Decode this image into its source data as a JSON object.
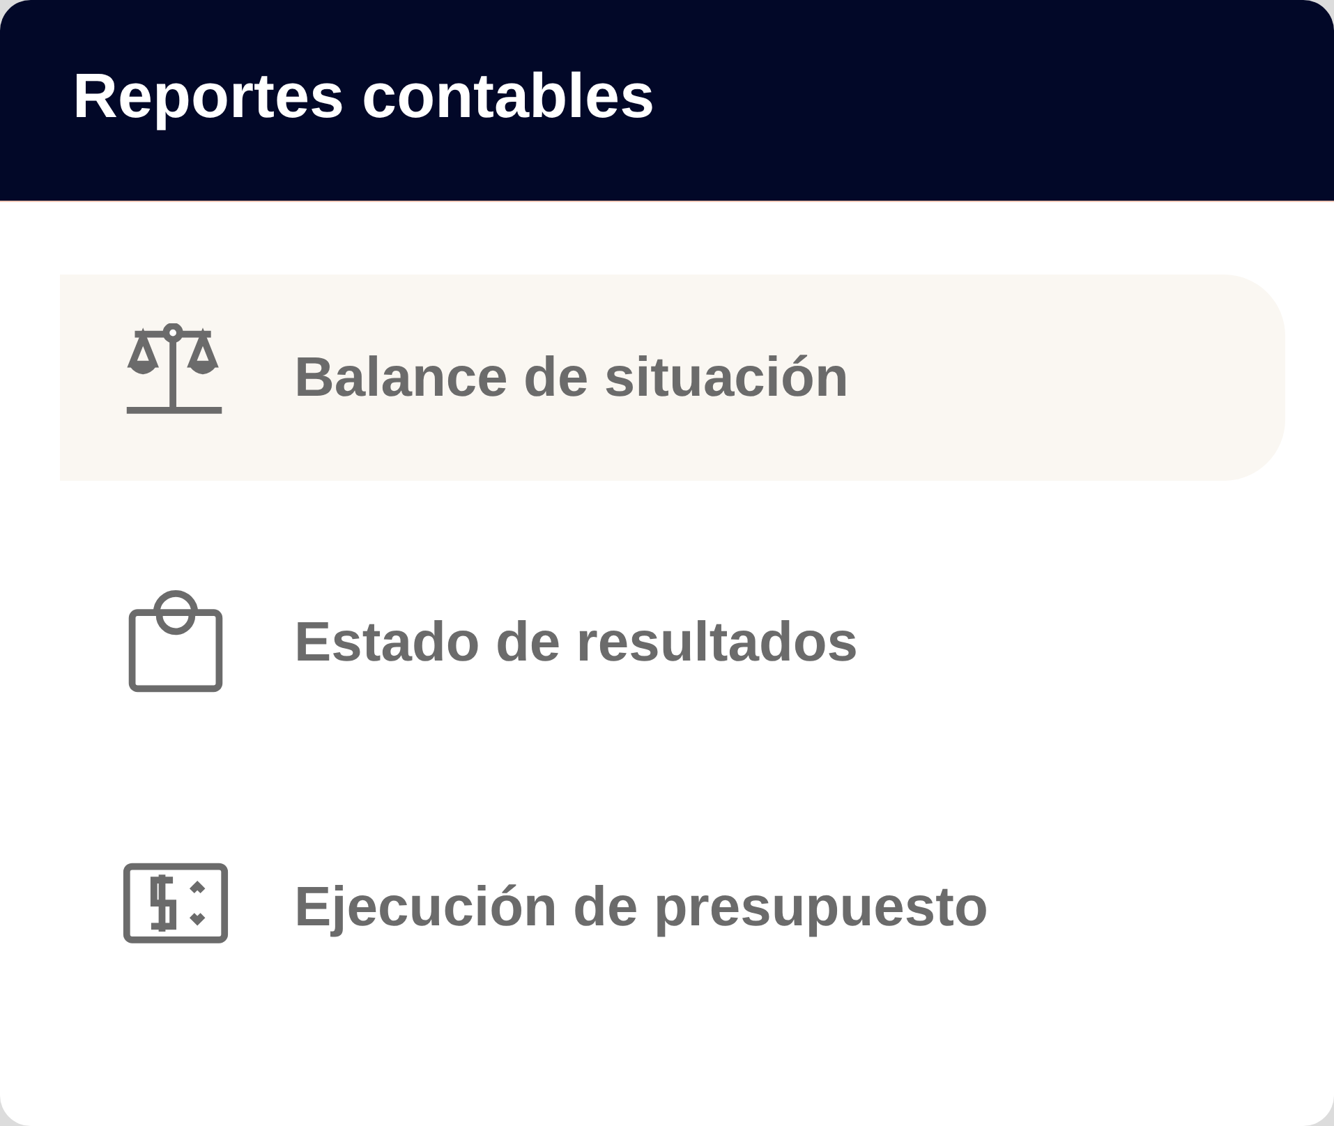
{
  "header": {
    "title": "Reportes contables"
  },
  "items": [
    {
      "kind": "scale",
      "label": "Balance de situación",
      "selected": true
    },
    {
      "kind": "bag",
      "label": "Estado de resultados",
      "selected": false
    },
    {
      "kind": "budget",
      "label": "Ejecución de presupuesto",
      "selected": false
    }
  ]
}
